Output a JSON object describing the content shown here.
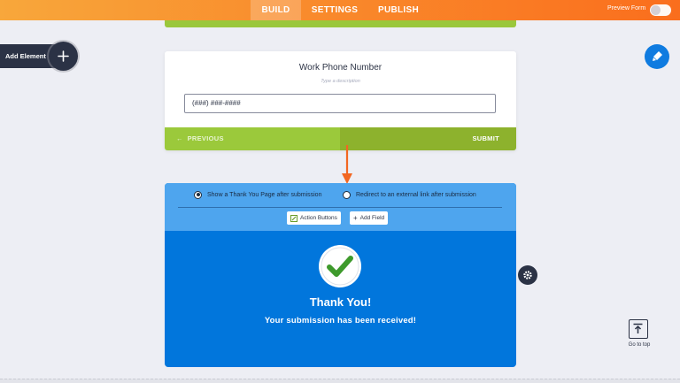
{
  "topbar": {
    "tabs": [
      {
        "label": "BUILD",
        "active": true
      },
      {
        "label": "SETTINGS",
        "active": false
      },
      {
        "label": "PUBLISH",
        "active": false
      }
    ],
    "preview_label": "Preview Form",
    "preview_enabled": false
  },
  "add_element": {
    "label": "Add Element",
    "icon": "plus-icon"
  },
  "paint_button": {
    "icon": "paint-roller-icon"
  },
  "form_card": {
    "field_title": "Work Phone Number",
    "field_description_placeholder": "Type a description",
    "input_value": "(###) ###-####",
    "prev_label": "PREVIOUS",
    "submit_label": "SUBMIT"
  },
  "thank_you": {
    "option_page": "Show a Thank You Page after submission",
    "option_redirect": "Redirect to an external link after submission",
    "selected_option": "page",
    "action_buttons_label": "Action Buttons",
    "add_field_label": "Add Field",
    "title": "Thank You!",
    "message": "Your submission has been received!"
  },
  "go_to_top": {
    "label": "Go to top"
  },
  "colors": {
    "orange": "#f98b2c",
    "green": "#9bc93b",
    "green_dark": "#8db22d",
    "blue": "#0176dc",
    "blue_light": "#4ea5ee",
    "arrow": "#f26722",
    "dark": "#2b3245"
  }
}
